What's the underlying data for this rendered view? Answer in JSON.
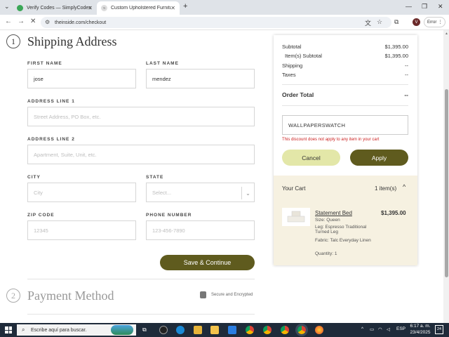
{
  "browser": {
    "tabs": [
      {
        "title": "Verify Codes — SimplyCodes",
        "active": false,
        "favicon_color": "#3aa757"
      },
      {
        "title": "Custom Upholstered Furniture",
        "active": true,
        "favicon_label": "TI"
      }
    ],
    "url": "theinside.com/checkout",
    "profile_initial": "V",
    "error_chip": "Error",
    "icons": [
      "back-icon",
      "forward-icon",
      "stop-icon",
      "tune-icon",
      "translate-icon",
      "star-icon",
      "extensions-icon",
      "menu-icon"
    ]
  },
  "shipping": {
    "step": "1",
    "title": "Shipping Address",
    "first_name_label": "FIRST NAME",
    "first_name_value": "jose",
    "last_name_label": "LAST NAME",
    "last_name_value": "mendez",
    "address1_label": "ADDRESS LINE 1",
    "address1_placeholder": "Street Address, PO Box, etc.",
    "address2_label": "ADDRESS LINE 2",
    "address2_placeholder": "Apartment, Suite, Unit, etc.",
    "city_label": "CITY",
    "city_placeholder": "City",
    "state_label": "STATE",
    "state_placeholder": "Select...",
    "zip_label": "ZIP CODE",
    "zip_placeholder": "12345",
    "phone_label": "PHONE NUMBER",
    "phone_placeholder": "123-456-7890",
    "continue_label": "Save & Continue"
  },
  "payment": {
    "step": "2",
    "title": "Payment Method",
    "secure_label": "Secure and Encrypted"
  },
  "summary": {
    "subtotal_label": "Subtotal",
    "subtotal_value": "$1,395.00",
    "items_subtotal_label": "Item(s) Subtotal",
    "items_subtotal_value": "$1,395.00",
    "shipping_label": "Shipping",
    "shipping_value": "--",
    "taxes_label": "Taxes",
    "taxes_value": "--",
    "total_label": "Order Total",
    "total_value": "--",
    "coupon_code": "WALLPAPERSWATCH",
    "coupon_error": "This discount does not apply to any item in your cart",
    "cancel_label": "Cancel",
    "apply_label": "Apply"
  },
  "cart": {
    "title": "Your Cart",
    "count": "1 item(s)",
    "product_name": "Statement Bed",
    "price": "$1,395.00",
    "size": "Size: Queen",
    "leg": "Leg: Espresso Traditional Turned Leg",
    "fabric": "Fabric: Talc Everyday Linen",
    "quantity": "Quantity: 1"
  },
  "taskbar": {
    "search_placeholder": "Escribe aquí para buscar.",
    "language": "ESP",
    "time": "6:17 a. m.",
    "date": "23/4/2025",
    "notification_count": "24"
  },
  "colors": {
    "primary_button": "#5f5b1e",
    "secondary_button": "#e3e7a8",
    "cart_bg": "#f6f1e1",
    "error": "#cc2222"
  }
}
